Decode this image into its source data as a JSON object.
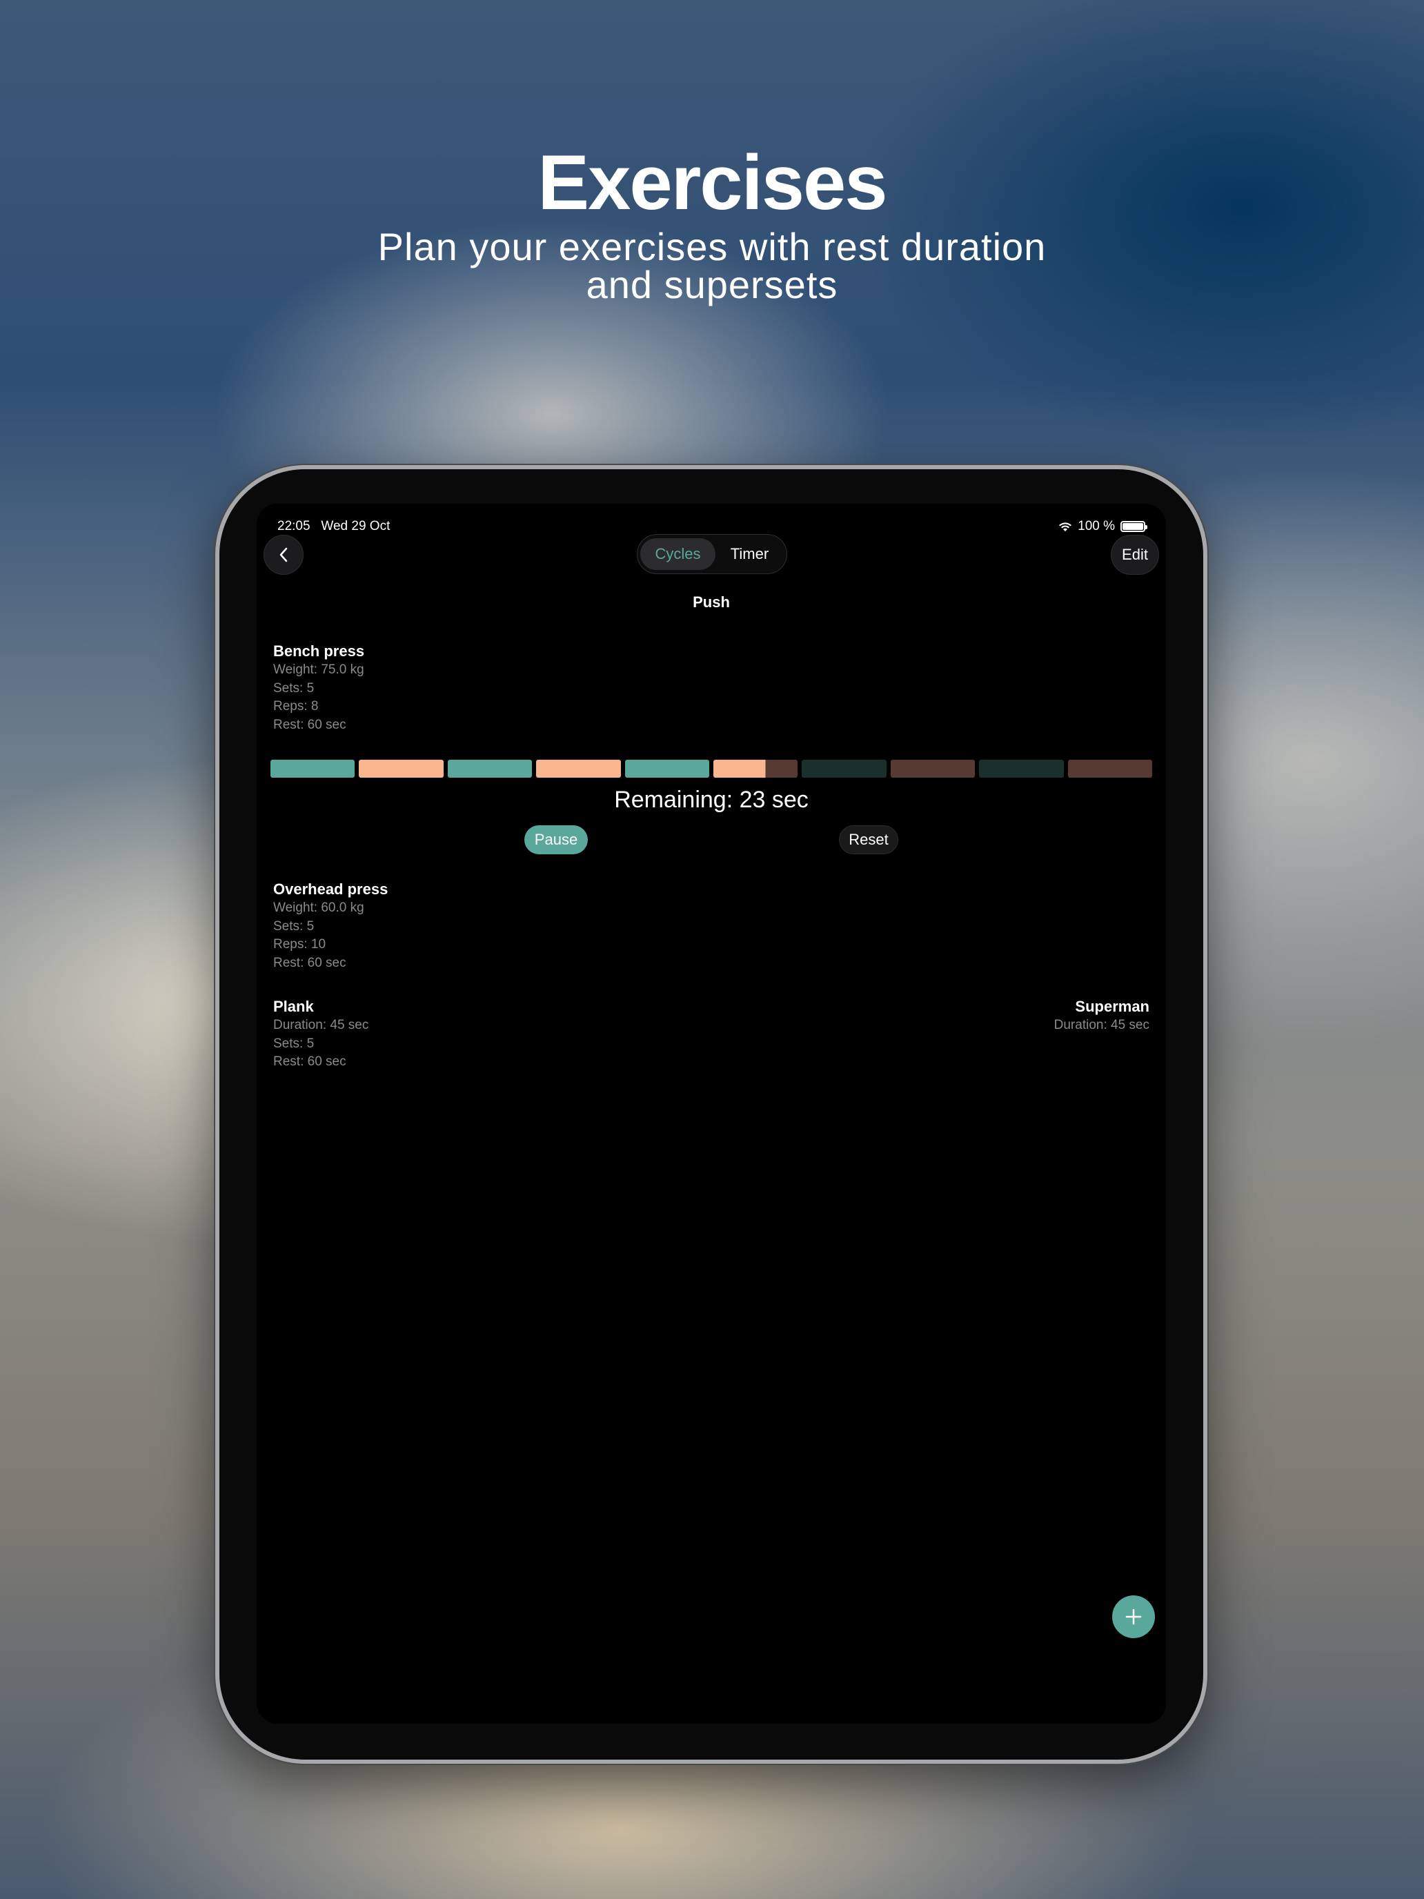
{
  "promo": {
    "title": "Exercises",
    "subtitle_line1": "Plan your exercises with rest duration",
    "subtitle_line2": "and supersets"
  },
  "status_bar": {
    "time": "22:05",
    "date": "Wed 29 Oct",
    "battery": "100 %"
  },
  "nav": {
    "back_icon": "chevron-left-icon",
    "tabs": [
      {
        "label": "Cycles",
        "selected": true
      },
      {
        "label": "Timer",
        "selected": false
      }
    ],
    "edit_label": "Edit"
  },
  "workout_title": "Push",
  "exercises": [
    {
      "name": "Bench press",
      "details": [
        "Weight: 75.0 kg",
        "Sets: 5",
        "Reps: 8",
        "Rest: 60 sec"
      ]
    },
    {
      "name": "Overhead press",
      "details": [
        "Weight: 60.0 kg",
        "Sets: 5",
        "Reps: 10",
        "Rest: 60 sec"
      ]
    },
    {
      "name": "Plank",
      "details": [
        "Duration: 45 sec",
        "Sets: 5",
        "Rest: 60 sec"
      ]
    }
  ],
  "superset": {
    "name": "Superman",
    "details": [
      "Duration: 45 sec"
    ]
  },
  "timer": {
    "remaining": "Remaining: 23 sec",
    "pause_label": "Pause",
    "reset_label": "Reset",
    "current_segment_progress": 0.62,
    "segments": [
      "set",
      "rest",
      "set",
      "rest",
      "set",
      "rest",
      "set",
      "rest",
      "set",
      "rest"
    ],
    "completed_segments": 5
  },
  "colors": {
    "accent": "#5aa89c",
    "set_done": "#5aa89c",
    "rest_done": "#f9b68f",
    "set_pending": "#1b302c",
    "rest_pending": "#573b32"
  },
  "fab_icon": "plus-icon"
}
